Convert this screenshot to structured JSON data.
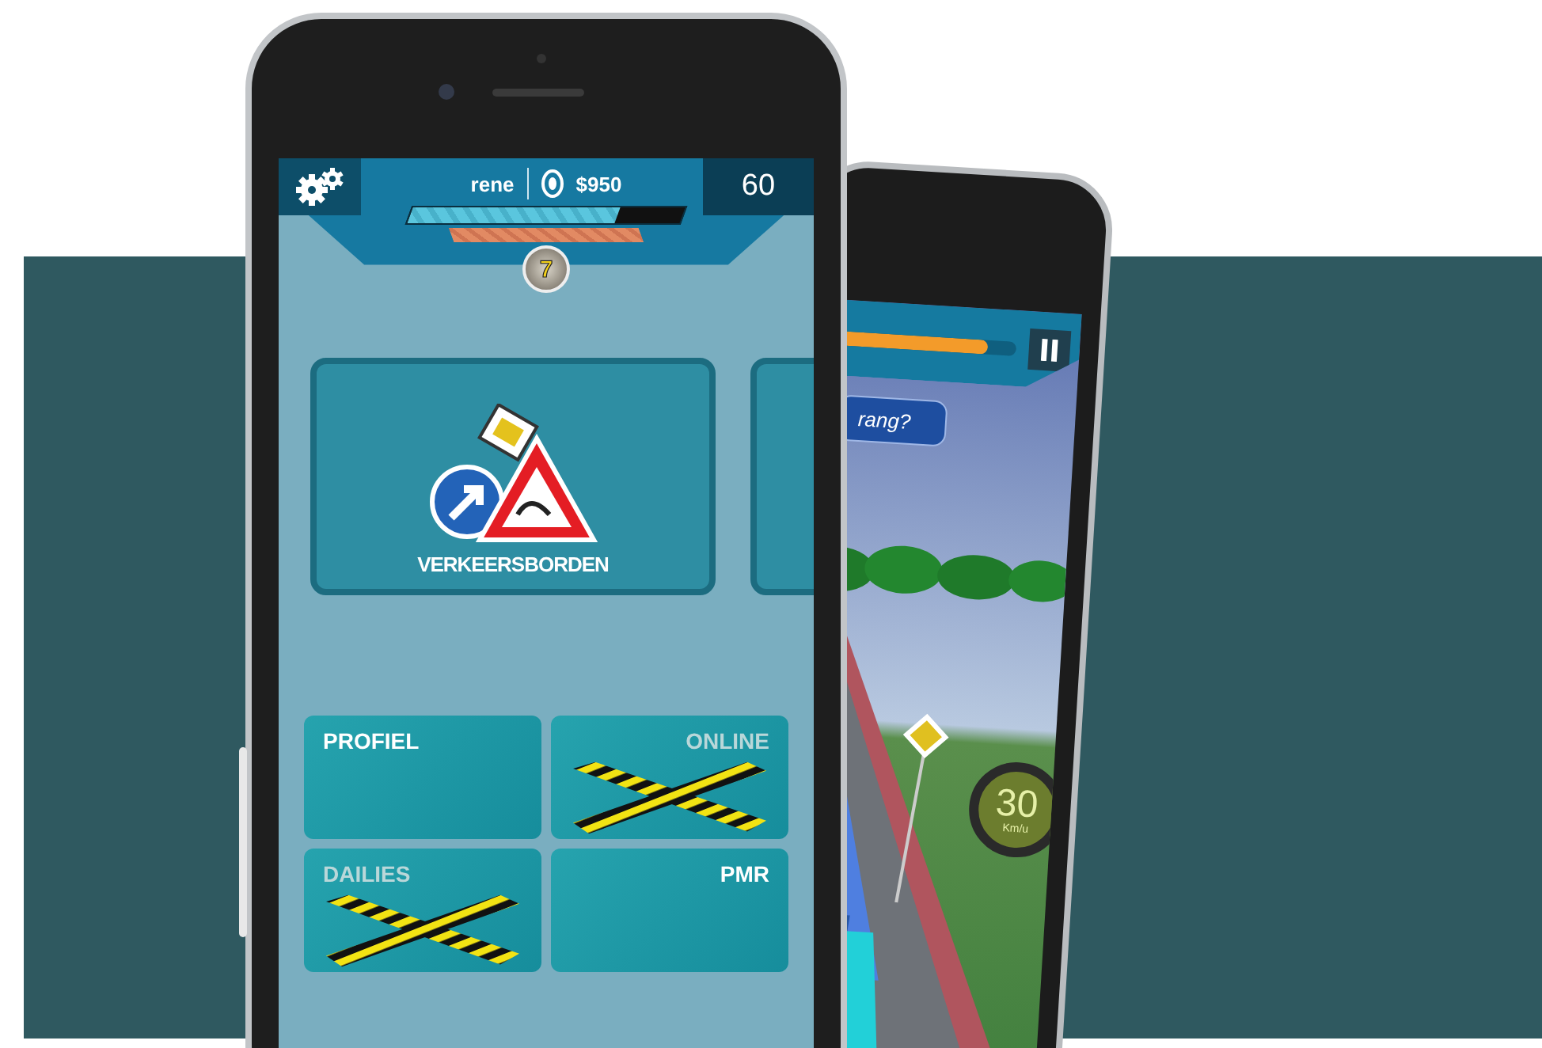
{
  "header": {
    "player": "rene",
    "coins": "$950",
    "counter": "60",
    "level_badge": "7",
    "xp_bar": {
      "level": 0.76
    },
    "stamina_bar": {
      "level": 1.0
    }
  },
  "featured_card": {
    "label": "VERKEERSBORDEN"
  },
  "menu_tiles": [
    {
      "label": "PROFIEL",
      "locked": false
    },
    {
      "label": "ONLINE",
      "locked": true
    },
    {
      "label": "DAILIES",
      "locked": true
    },
    {
      "label": "PMR",
      "locked": false
    }
  ],
  "game_screen": {
    "question": "rang?",
    "progress": {
      "level": 0.85
    },
    "speed": "30",
    "speed_unit": "Km/u"
  }
}
